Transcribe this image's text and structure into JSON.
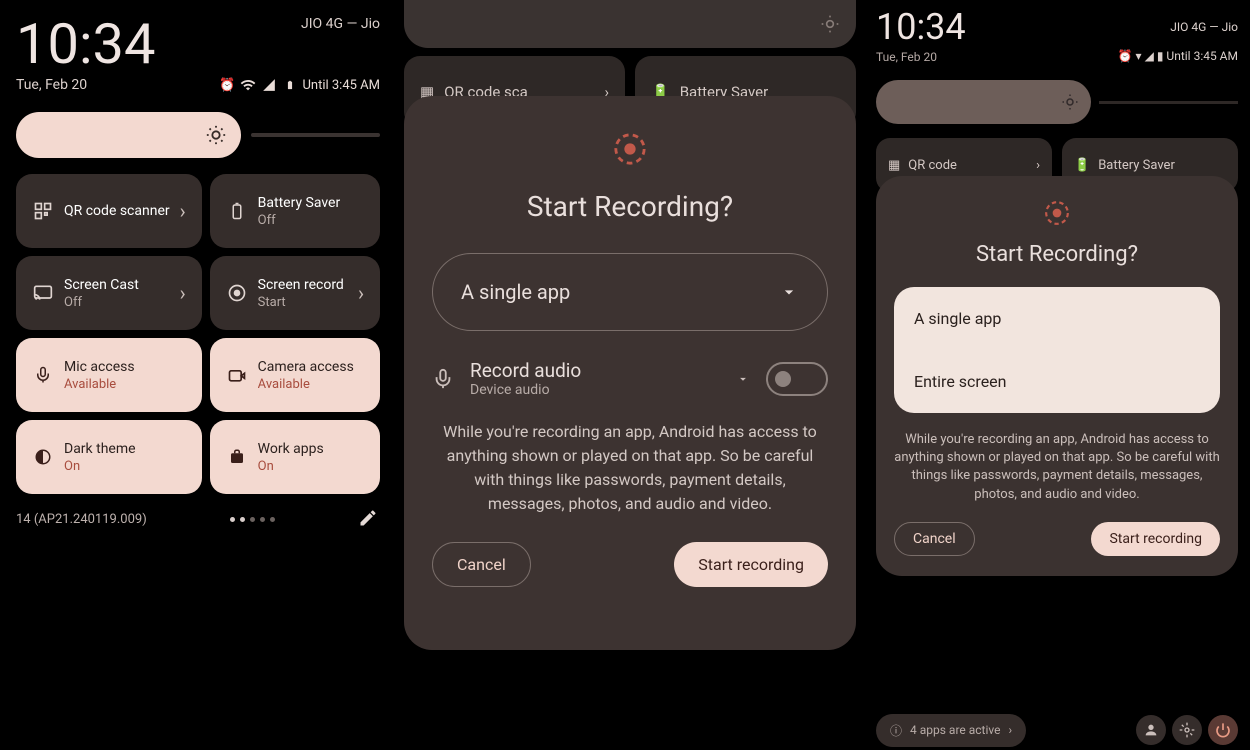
{
  "panel1": {
    "clock": "10:34",
    "carrier": "JIO 4G — Jio",
    "date": "Tue, Feb 20",
    "until": "Until 3:45 AM",
    "tiles": [
      {
        "label": "QR code scanner",
        "status": "",
        "active": false,
        "icon": "qr",
        "chev": true
      },
      {
        "label": "Battery Saver",
        "status": "Off",
        "active": false,
        "icon": "battery",
        "chev": false
      },
      {
        "label": "Screen Cast",
        "status": "Off",
        "active": false,
        "icon": "cast",
        "chev": true
      },
      {
        "label": "Screen record",
        "status": "Start",
        "active": false,
        "icon": "record",
        "chev": true
      },
      {
        "label": "Mic access",
        "status": "Available",
        "active": true,
        "icon": "mic",
        "chev": false
      },
      {
        "label": "Camera access",
        "status": "Available",
        "active": true,
        "icon": "camera",
        "chev": false
      },
      {
        "label": "Dark theme",
        "status": "On",
        "active": true,
        "icon": "dark",
        "chev": false
      },
      {
        "label": "Work apps",
        "status": "On",
        "active": true,
        "icon": "work",
        "chev": false
      }
    ],
    "build": "14 (AP21.240119.009)"
  },
  "panel2": {
    "title": "Start Recording?",
    "dropdown": "A single app",
    "audio_title": "Record audio",
    "audio_sub": "Device audio",
    "warning": "While you're recording an app, Android has access to anything shown or played on that app. So be careful with things like passwords, payment details, messages, photos, and audio and video.",
    "cancel": "Cancel",
    "start": "Start recording",
    "bg_tiles": [
      {
        "label": "QR code sca",
        "icon": "qr"
      },
      {
        "label": "Battery Saver",
        "icon": "battery"
      }
    ]
  },
  "panel3": {
    "clock": "10:34",
    "carrier": "JIO 4G — Jio",
    "date": "Tue, Feb 20",
    "until": "Until 3:45 AM",
    "bg_tiles": [
      {
        "label": "QR code"
      },
      {
        "label": "Battery Saver"
      }
    ],
    "title": "Start Recording?",
    "options": [
      "A single app",
      "Entire screen"
    ],
    "warning": "While you're recording an app, Android has access to anything shown or played on that app. So be careful with things like passwords, payment details, messages, photos, and audio and video.",
    "cancel": "Cancel",
    "start": "Start recording",
    "footer_text": "4 apps are active"
  }
}
